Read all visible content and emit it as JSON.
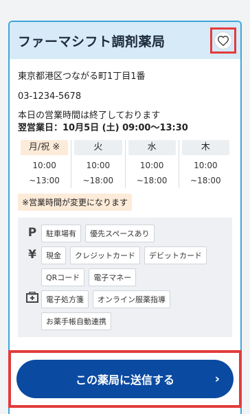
{
  "pharmacy": {
    "name": "ファーマシフト調剤薬局",
    "address": "東京都港区つながる町1丁目1番",
    "phone": "03-1234-5678",
    "status_note": "本日の営業時間は終了しております",
    "next_business_day": "翌営業日：10月5日 (土) 09:00〜13:30"
  },
  "schedule": {
    "days": [
      {
        "label": "月/祝 ※",
        "holiday": true,
        "open": "10:00",
        "close": "~13:00"
      },
      {
        "label": "火",
        "holiday": false,
        "open": "10:00",
        "close": "~18:00"
      },
      {
        "label": "水",
        "holiday": false,
        "open": "10:00",
        "close": "~18:00"
      },
      {
        "label": "木",
        "holiday": false,
        "open": "10:00",
        "close": "~18:00"
      }
    ],
    "change_note": "※営業時間が変更になります"
  },
  "amenities": {
    "parking": {
      "icon": "parking-icon",
      "tags": [
        "駐車場有",
        "優先スペースあり"
      ]
    },
    "payment": {
      "icon": "yen-icon",
      "tags": [
        "現金",
        "クレジットカード",
        "デビットカード",
        "QRコード",
        "電子マネー"
      ]
    },
    "services": {
      "icon": "medicine-box-icon",
      "tags": [
        "電子処方箋",
        "オンライン服薬指導",
        "お薬手帳自動連携"
      ]
    }
  },
  "cta": {
    "label": "この薬局に送信する",
    "chevron": "›"
  },
  "colors": {
    "header_bg": "#d6eaf8",
    "border": "#3fa6d8",
    "cta": "#0b4aa1",
    "highlight": "#e23b3b",
    "holiday_bg": "#fdebd9"
  }
}
